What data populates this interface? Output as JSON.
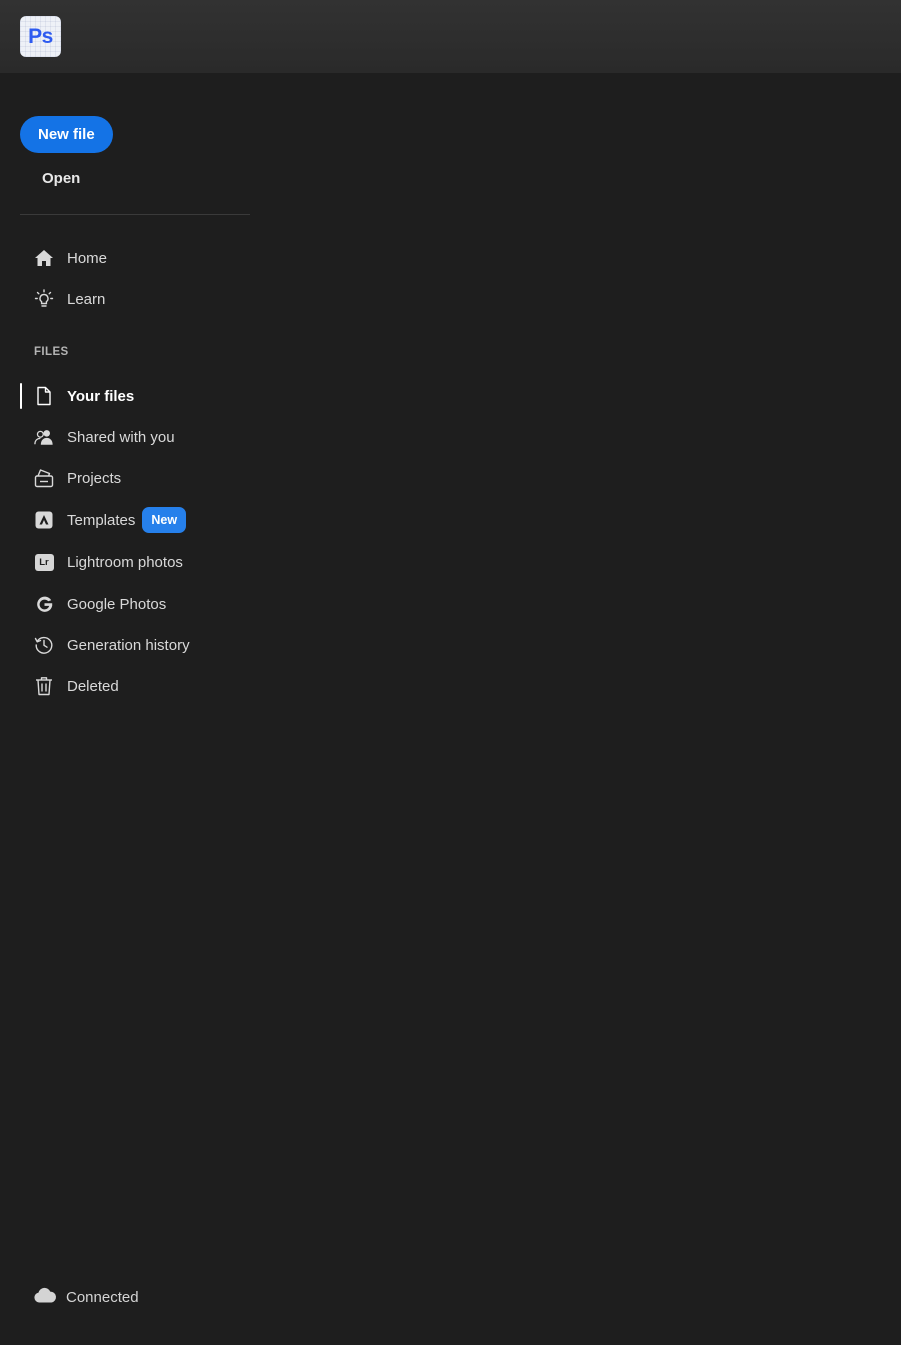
{
  "app": {
    "logo_text": "Ps"
  },
  "sidebar": {
    "new_file_label": "New file",
    "open_label": "Open",
    "main_items": [
      {
        "label": "Home",
        "icon": "home-icon"
      },
      {
        "label": "Learn",
        "icon": "lightbulb-icon"
      }
    ],
    "files_section_label": "FILES",
    "file_items": [
      {
        "label": "Your files",
        "icon": "file-icon",
        "active": true
      },
      {
        "label": "Shared with you",
        "icon": "users-icon"
      },
      {
        "label": "Projects",
        "icon": "projects-icon"
      },
      {
        "label": "Templates",
        "icon": "templates-icon",
        "badge": "New"
      },
      {
        "label": "Lightroom photos",
        "icon": "lightroom-icon",
        "icon_text": "Lr"
      },
      {
        "label": "Google Photos",
        "icon": "google-icon"
      },
      {
        "label": "Generation history",
        "icon": "history-icon"
      },
      {
        "label": "Deleted",
        "icon": "trash-icon"
      }
    ]
  },
  "status": {
    "label": "Connected",
    "icon": "cloud-icon"
  },
  "colors": {
    "accent": "#1473e6",
    "badge": "#2680eb",
    "background": "#1e1e1e",
    "topbar": "#2e2e2e",
    "logo_text": "#2e5bf0"
  }
}
